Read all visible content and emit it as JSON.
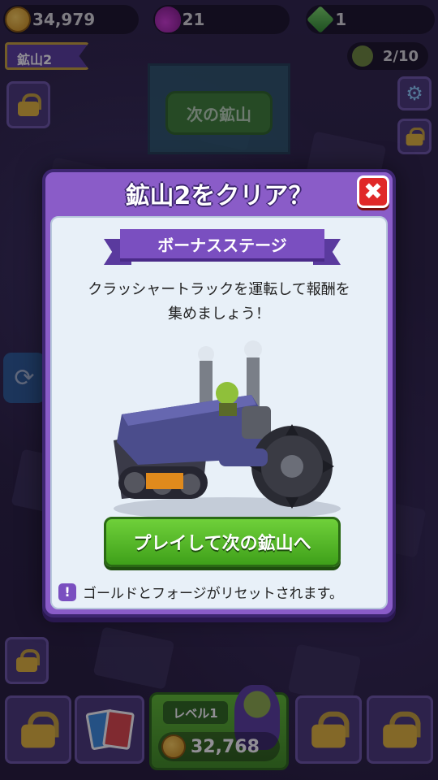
{
  "top_bar": {
    "gold": "34,979",
    "potions": "21",
    "gems": "1"
  },
  "mine_tag": "鉱山2",
  "goblins": "2/10",
  "background": {
    "next_mine_label": "次の鉱山"
  },
  "modal": {
    "title": "鉱山2をクリア？",
    "ribbon": "ボーナスステージ",
    "description_line1": "クラッシャートラックを運転して報酬を",
    "description_line2": "集めましょう！",
    "play_button": "プレイして次の鉱山へ",
    "warning_icon": "!",
    "warning": "ゴールドとフォージがリセットされます。",
    "close_icon": "✖"
  },
  "bottom_bar": {
    "level_label": "レベル1",
    "level_cost": "32,768"
  },
  "colors": {
    "modal_frame": "#8a5cc8",
    "play_green": "#4fb824",
    "close_red": "#e02828"
  }
}
